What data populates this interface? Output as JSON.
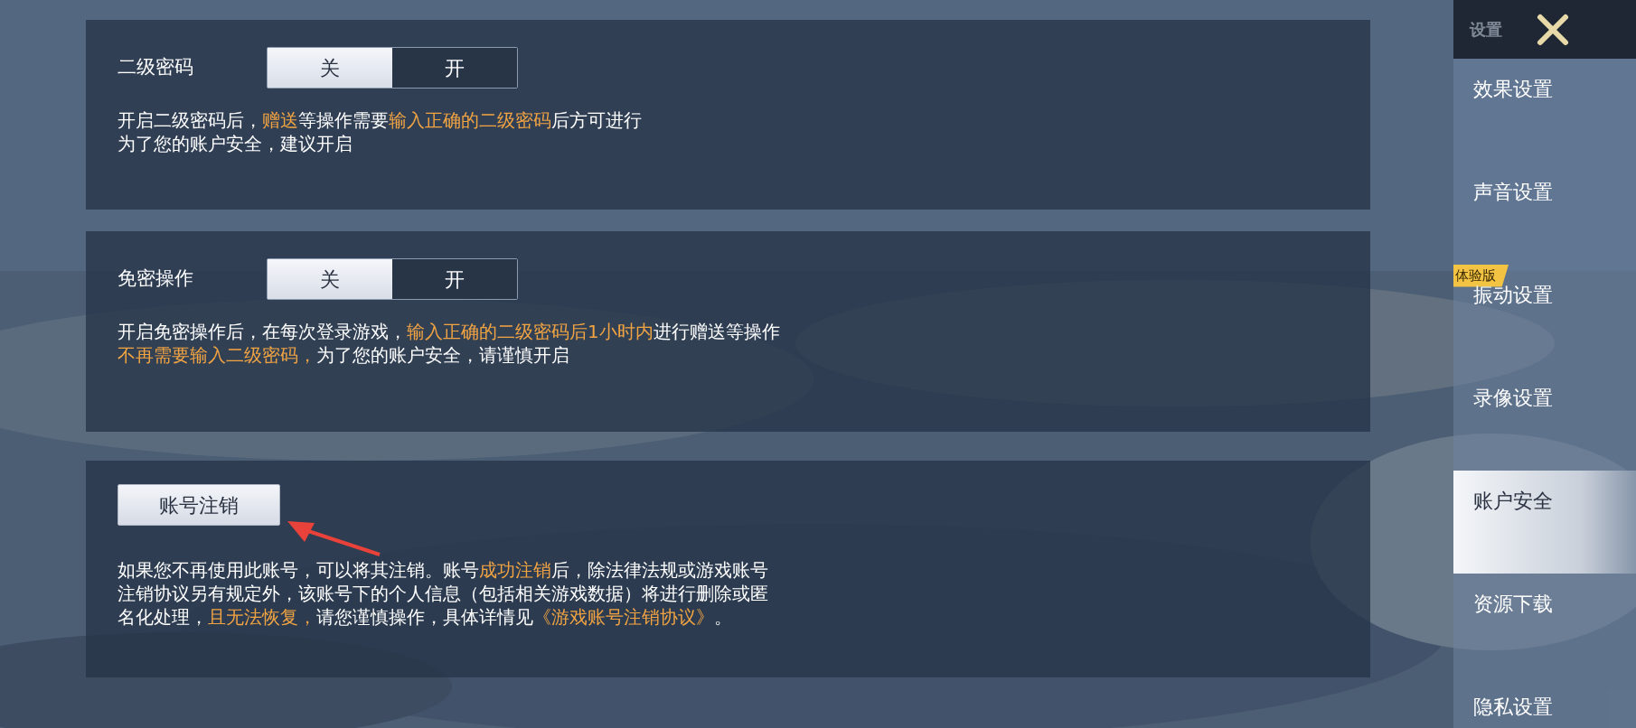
{
  "panels": [
    {
      "kind": "toggle",
      "label": "二级密码",
      "options": [
        {
          "label": "关",
          "selected": true
        },
        {
          "label": "开",
          "selected": false
        }
      ],
      "lines": [
        [
          {
            "text": "开启二级密码后，",
            "highlight": false
          },
          {
            "text": "赠送",
            "highlight": true
          },
          {
            "text": "等操作需要",
            "highlight": false
          },
          {
            "text": "输入正确的二级密码",
            "highlight": true
          },
          {
            "text": "后方可进行",
            "highlight": false
          }
        ],
        [
          {
            "text": "为了您的账户安全，建议开启",
            "highlight": false
          }
        ]
      ]
    },
    {
      "kind": "toggle",
      "label": "免密操作",
      "options": [
        {
          "label": "关",
          "selected": true
        },
        {
          "label": "开",
          "selected": false
        }
      ],
      "lines": [
        [
          {
            "text": "开启免密操作后，在每次登录游戏，",
            "highlight": false
          },
          {
            "text": "输入正确的二级密码后1小时内",
            "highlight": true
          },
          {
            "text": "进行赠送等操作",
            "highlight": false
          }
        ],
        [
          {
            "text": "不再需要输入二级密码，",
            "highlight": true
          },
          {
            "text": "为了您的账户安全，请谨慎开启",
            "highlight": false
          }
        ]
      ]
    },
    {
      "kind": "button",
      "button": "账号注销",
      "lines": [
        [
          {
            "text": "如果您不再使用此账号，可以将其注销。账号",
            "highlight": false
          },
          {
            "text": "成功注销",
            "highlight": true
          },
          {
            "text": "后，除法律法规或游戏账号",
            "highlight": false
          }
        ],
        [
          {
            "text": "注销协议另有规定外，该账号下的个人信息（包括相关游戏数据）将进行删除或匿",
            "highlight": false
          }
        ],
        [
          {
            "text": "名化处理，",
            "highlight": false
          },
          {
            "text": "且无法恢复，",
            "highlight": true
          },
          {
            "text": "请您谨慎操作，具体详情见",
            "highlight": false
          },
          {
            "text": "《游戏账号注销协议》",
            "highlight": true
          },
          {
            "text": "。",
            "highlight": false
          }
        ]
      ]
    }
  ],
  "sidebar": {
    "title": "设置",
    "items": [
      {
        "label": "效果设置",
        "selected": false
      },
      {
        "label": "声音设置",
        "selected": false
      },
      {
        "label": "振动设置",
        "selected": false,
        "badge": "体验版"
      },
      {
        "label": "录像设置",
        "selected": false
      },
      {
        "label": "账户安全",
        "selected": true
      },
      {
        "label": "资源下载",
        "selected": false
      },
      {
        "label": "隐私设置",
        "selected": false
      }
    ]
  }
}
